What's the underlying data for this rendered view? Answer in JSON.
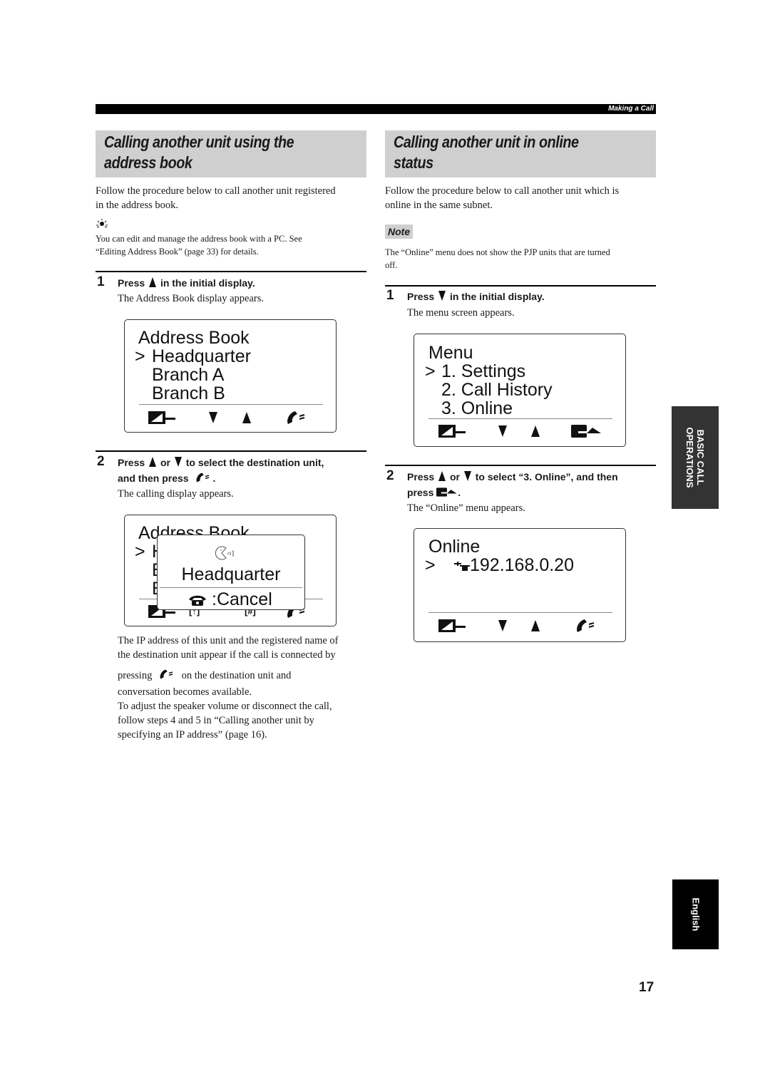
{
  "header": {
    "section_label": "Making a Call"
  },
  "left": {
    "title_line1": "Calling another unit using the",
    "title_line2": "address book",
    "intro_line1": "Follow the procedure below to call another unit registered",
    "intro_line2": "in the address book.",
    "hint_icon": "lightbulb-hint-icon",
    "hint_line1": "You can edit and manage the address book with a PC. See",
    "hint_line2": "“Editing Address Book” (page 33) for details.",
    "step1": {
      "number": "1",
      "title_pre": "Press",
      "title_post": "in the initial display.",
      "desc": "The Address Book display appears."
    },
    "lcd1": {
      "line1": "Address Book",
      "cursor": ">",
      "line2": "Headquarter",
      "line3": "Branch A",
      "line4": "Branch B",
      "softkeys": [
        "back-icon",
        "down-arrow-icon",
        "up-arrow-icon",
        "call-handset-icon"
      ]
    },
    "step2": {
      "number": "2",
      "title_pre": "Press",
      "title_mid": "or",
      "title_post": "to select the destination unit,",
      "title_line2_pre": "and then press",
      "title_line2_post": ".",
      "desc": "The calling display appears."
    },
    "lcd2": {
      "bg_line1": "Address Book",
      "bg_cursor": ">",
      "bg_frag2": "H",
      "bg_frag3": "B",
      "bg_frag4": "B",
      "popup_icon": "calling-face-icon",
      "popup_name": "Headquarter",
      "popup_cancel": ":Cancel",
      "key_left": "[↑]",
      "key_right": "[#]"
    },
    "after_text": {
      "p1_line1": "The IP address of this unit and the registered name of",
      "p1_line2": "the destination unit appear if the call is connected by",
      "p1_line3_pre": "pressing",
      "p1_line3_post": "on the destination unit and",
      "p1_line4": "conversation becomes available.",
      "p2_line1": "To adjust the speaker volume or disconnect the call,",
      "p2_line2": "follow steps 4 and 5 in “Calling another unit by",
      "p2_line3": "specifying an IP address” (page 16)."
    }
  },
  "right": {
    "title_line1": "Calling another unit in online",
    "title_line2": "status",
    "intro_line1": "Follow the procedure below to call another unit which is",
    "intro_line2": "online in the same subnet.",
    "note_label": "Note",
    "note_line1": "The “Online” menu does not show the PJP units that are turned",
    "note_line2": "off.",
    "step1": {
      "number": "1",
      "title_pre": "Press",
      "title_post": "in the initial display.",
      "desc": "The menu screen appears."
    },
    "lcd1": {
      "line1": "Menu",
      "cursor": ">",
      "line2": "1. Settings",
      "line3": "2. Call History",
      "line4": "3. Online",
      "softkeys": [
        "back-icon",
        "down-arrow-icon",
        "up-arrow-icon",
        "enter-icon"
      ]
    },
    "step2": {
      "number": "2",
      "title_pre": "Press",
      "title_mid": "or",
      "title_post": "to select “3. Online”, and then",
      "title_line2_pre": "press",
      "title_line2_post": ".",
      "desc": "The “Online” menu appears."
    },
    "lcd2": {
      "line1": "Online",
      "cursor": ">",
      "ip": "192.168.0.20",
      "softkeys": [
        "back-icon",
        "down-arrow-icon",
        "up-arrow-icon",
        "call-handset-icon"
      ]
    }
  },
  "side_tabs": {
    "chapter_line1": "BASIC CALL",
    "chapter_line2": "OPERATIONS",
    "language": "English"
  },
  "footer": {
    "page_number": "17"
  }
}
